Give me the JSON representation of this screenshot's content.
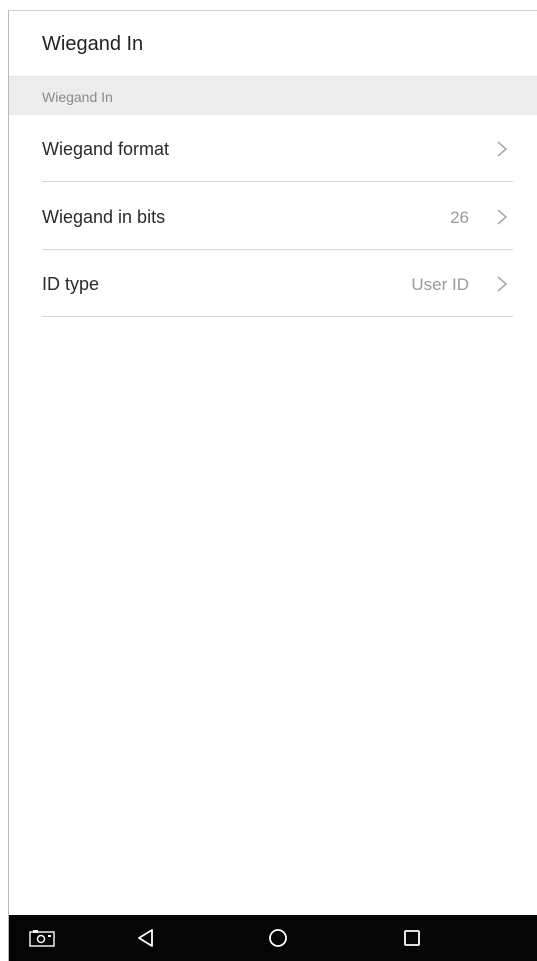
{
  "header": {
    "title": "Wiegand In"
  },
  "section": {
    "label": "Wiegand In"
  },
  "settings": [
    {
      "label": "Wiegand format",
      "value": ""
    },
    {
      "label": "Wiegand in bits",
      "value": "26"
    },
    {
      "label": "ID type",
      "value": "User ID"
    }
  ],
  "nav_bar": {
    "icons": [
      "screenshot-icon",
      "back-icon",
      "home-icon",
      "recents-icon"
    ]
  },
  "colors": {
    "nav_bar_background": "#050505",
    "section_background": "#ececec",
    "divider": "#d6d6d6",
    "value_text": "#9a9a9a"
  }
}
